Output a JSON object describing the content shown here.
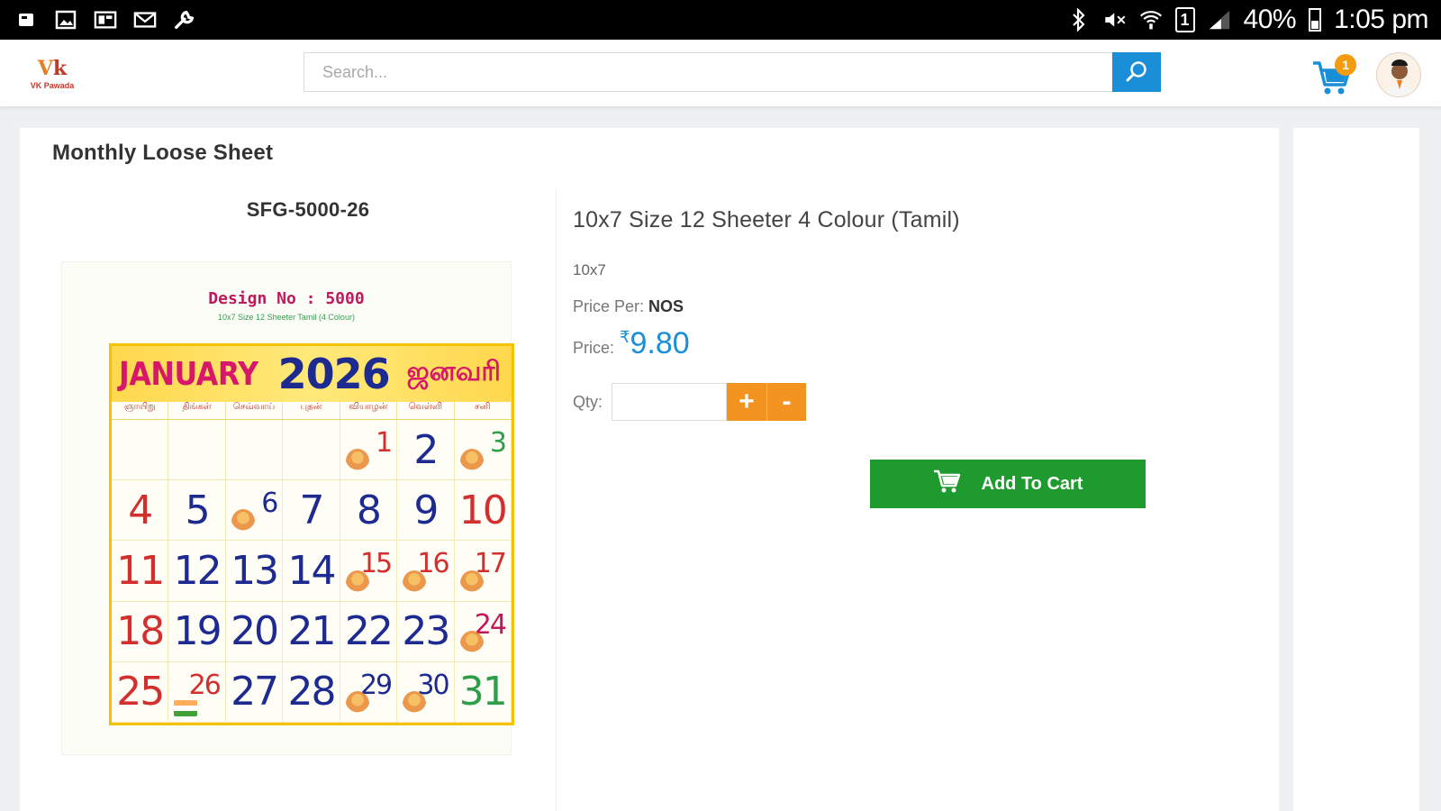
{
  "status_bar": {
    "battery": "40%",
    "time": "1:05 pm",
    "sim": "1"
  },
  "header": {
    "logo_text": "VK Pawada",
    "search": {
      "placeholder": "Search..."
    },
    "cart_count": "1"
  },
  "page": {
    "title": "Monthly Loose Sheet",
    "sku": "SFG-5000-26"
  },
  "product_image": {
    "design_no": "Design No : 5000",
    "design_sub": "10x7 Size 12 Sheeter Tamil (4 Colour)",
    "month": "JANUARY",
    "year": "2026",
    "month_tamil": "ஜனவரி",
    "weekdays": [
      "ஞாயிறு",
      "திங்கள்",
      "செவ்வாய்",
      "புதன்",
      "வியாழன்",
      "வெள்ளி",
      "சனி"
    ],
    "days": {
      "d1": "1",
      "d2": "2",
      "d3": "3",
      "d4": "4",
      "d5": "5",
      "d6": "6",
      "d7": "7",
      "d8": "8",
      "d9": "9",
      "d10": "10",
      "d11": "11",
      "d12": "12",
      "d13": "13",
      "d14": "14",
      "d15": "15",
      "d16": "16",
      "d17": "17",
      "d18": "18",
      "d19": "19",
      "d20": "20",
      "d21": "21",
      "d22": "22",
      "d23": "23",
      "d24": "24",
      "d25": "25",
      "d26": "26",
      "d27": "27",
      "d28": "28",
      "d29": "29",
      "d30": "30",
      "d31": "31"
    }
  },
  "product": {
    "name": "10x7 Size 12 Sheeter 4 Colour (Tamil)",
    "size": "10x7",
    "price_per_label": "Price Per: ",
    "price_per_unit": "NOS",
    "price_label": "Price:",
    "currency": "₹",
    "price": "9.80",
    "qty_label": "Qty:",
    "qty_value": "",
    "plus": "+",
    "minus": "-",
    "add_to_cart": "Add To Cart"
  },
  "colors": {
    "accent_blue": "#1a8fd8",
    "cart_green": "#1f9a2e",
    "qty_orange": "#f2941f"
  }
}
